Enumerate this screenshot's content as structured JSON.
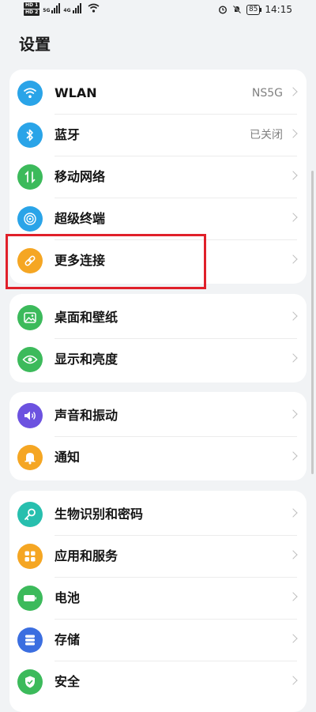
{
  "status_bar": {
    "sim1": "HD",
    "sim1_slot": "1",
    "sim2": "HD",
    "sim2_slot": "2",
    "net1": "5G",
    "net2": "4G",
    "battery": "85",
    "time": "14:15"
  },
  "title": "设置",
  "groups": [
    {
      "items": [
        {
          "label": "WLAN",
          "value": "NS5G",
          "icon": "wifi-icon",
          "color": "#2aa4e8"
        },
        {
          "label": "蓝牙",
          "value": "已关闭",
          "icon": "bluetooth-icon",
          "color": "#2aa4e8"
        },
        {
          "label": "移动网络",
          "value": "",
          "icon": "mobile-data-icon",
          "color": "#3cba5b"
        },
        {
          "label": "超级终端",
          "value": "",
          "icon": "super-device-icon",
          "color": "#2aa4e8"
        },
        {
          "label": "更多连接",
          "value": "",
          "icon": "link-icon",
          "color": "#f5a623"
        }
      ]
    },
    {
      "items": [
        {
          "label": "桌面和壁纸",
          "value": "",
          "icon": "wallpaper-icon",
          "color": "#3cba5b"
        },
        {
          "label": "显示和亮度",
          "value": "",
          "icon": "eye-icon",
          "color": "#3cba5b"
        }
      ]
    },
    {
      "items": [
        {
          "label": "声音和振动",
          "value": "",
          "icon": "speaker-icon",
          "color": "#6c52e0"
        },
        {
          "label": "通知",
          "value": "",
          "icon": "bell-icon",
          "color": "#f5a623"
        }
      ]
    },
    {
      "items": [
        {
          "label": "生物识别和密码",
          "value": "",
          "icon": "key-icon",
          "color": "#27bfae"
        },
        {
          "label": "应用和服务",
          "value": "",
          "icon": "apps-grid-icon",
          "color": "#f5a623"
        },
        {
          "label": "电池",
          "value": "",
          "icon": "battery-icon",
          "color": "#3cba5b"
        },
        {
          "label": "存储",
          "value": "",
          "icon": "storage-icon",
          "color": "#3b6ee0"
        },
        {
          "label": "安全",
          "value": "",
          "icon": "shield-icon",
          "color": "#3cba5b"
        }
      ]
    }
  ]
}
